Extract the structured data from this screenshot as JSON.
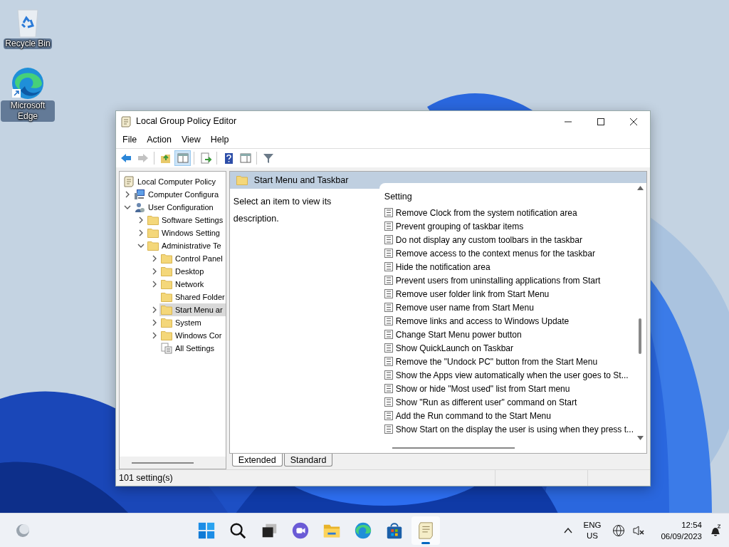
{
  "desktop_icons": [
    {
      "kind": "recycle",
      "label": "Recycle Bin"
    },
    {
      "kind": "edge",
      "label": "Microsoft Edge"
    }
  ],
  "window": {
    "title": "Local Group Policy Editor"
  },
  "menu": [
    "File",
    "Action",
    "View",
    "Help"
  ],
  "toolbar": [
    {
      "kind": "back",
      "disabled": false
    },
    {
      "kind": "forward",
      "disabled": true
    },
    {
      "kind": "sep"
    },
    {
      "kind": "up",
      "disabled": false
    },
    {
      "kind": "tree",
      "disabled": false,
      "selected": true
    },
    {
      "kind": "sep"
    },
    {
      "kind": "export",
      "disabled": false
    },
    {
      "kind": "sep"
    },
    {
      "kind": "help",
      "disabled": false
    },
    {
      "kind": "pane",
      "disabled": false
    },
    {
      "kind": "sep"
    },
    {
      "kind": "filter",
      "disabled": false
    }
  ],
  "tree": [
    {
      "label": "Local Computer Policy",
      "kind": "policy",
      "selected": false,
      "children": [
        {
          "label": "Computer Configura",
          "kind": "computer",
          "expanded": false,
          "selected": false
        },
        {
          "label": "User Configuration",
          "kind": "user",
          "expanded": true,
          "selected": false,
          "children": [
            {
              "label": "Software Settings",
              "kind": "folder",
              "expanded": false,
              "selected": false
            },
            {
              "label": "Windows Setting",
              "kind": "folder",
              "expanded": false,
              "selected": false
            },
            {
              "label": "Administrative Te",
              "kind": "folder",
              "expanded": true,
              "selected": false,
              "children": [
                {
                  "label": "Control Panel",
                  "kind": "folder",
                  "expanded": false,
                  "selected": false
                },
                {
                  "label": "Desktop",
                  "kind": "folder",
                  "expanded": false,
                  "selected": false
                },
                {
                  "label": "Network",
                  "kind": "folder",
                  "expanded": false,
                  "selected": false
                },
                {
                  "label": "Shared Folder",
                  "kind": "folder",
                  "selected": false
                },
                {
                  "label": "Start Menu ar",
                  "kind": "folder",
                  "expanded": false,
                  "selected": true
                },
                {
                  "label": "System",
                  "kind": "folder",
                  "expanded": false,
                  "selected": false
                },
                {
                  "label": "Windows Cor",
                  "kind": "folder",
                  "expanded": false,
                  "selected": false
                },
                {
                  "label": "All Settings",
                  "kind": "settings",
                  "selected": false
                }
              ]
            }
          ]
        }
      ]
    }
  ],
  "details": {
    "heading": "Start Menu and Taskbar",
    "description": "Select an item to view its description.",
    "column": "Setting",
    "settings": [
      "Remove Clock from the system notification area",
      "Prevent grouping of taskbar items",
      "Do not display any custom toolbars in the taskbar",
      "Remove access to the context menus for the taskbar",
      "Hide the notification area",
      "Prevent users from uninstalling applications from Start",
      "Remove user folder link from Start Menu",
      "Remove user name from Start Menu",
      "Remove links and access to Windows Update",
      "Change Start Menu power button",
      "Show QuickLaunch on Taskbar",
      "Remove the \"Undock PC\" button from the Start Menu",
      "Show the Apps view automatically when the user goes to St...",
      "Show or hide \"Most used\" list from Start menu",
      "Show \"Run as different user\" command on Start",
      "Add the Run command to the Start Menu",
      "Show Start on the display the user is using when they press t..."
    ]
  },
  "view_tabs": [
    {
      "label": "Extended",
      "selected": true
    },
    {
      "label": "Standard",
      "selected": false
    }
  ],
  "status_bar": "101 setting(s)",
  "taskbar": {
    "apps": [
      {
        "kind": "start",
        "active": false
      },
      {
        "kind": "search",
        "active": false
      },
      {
        "kind": "taskview",
        "active": false
      },
      {
        "kind": "chat",
        "active": false
      },
      {
        "kind": "explorer",
        "active": false
      },
      {
        "kind": "edge",
        "active": false
      },
      {
        "kind": "store",
        "active": false
      },
      {
        "kind": "gpedit",
        "active": true
      }
    ],
    "language": [
      "ENG",
      "US"
    ],
    "time": "12:54",
    "date": "06/09/2023"
  }
}
